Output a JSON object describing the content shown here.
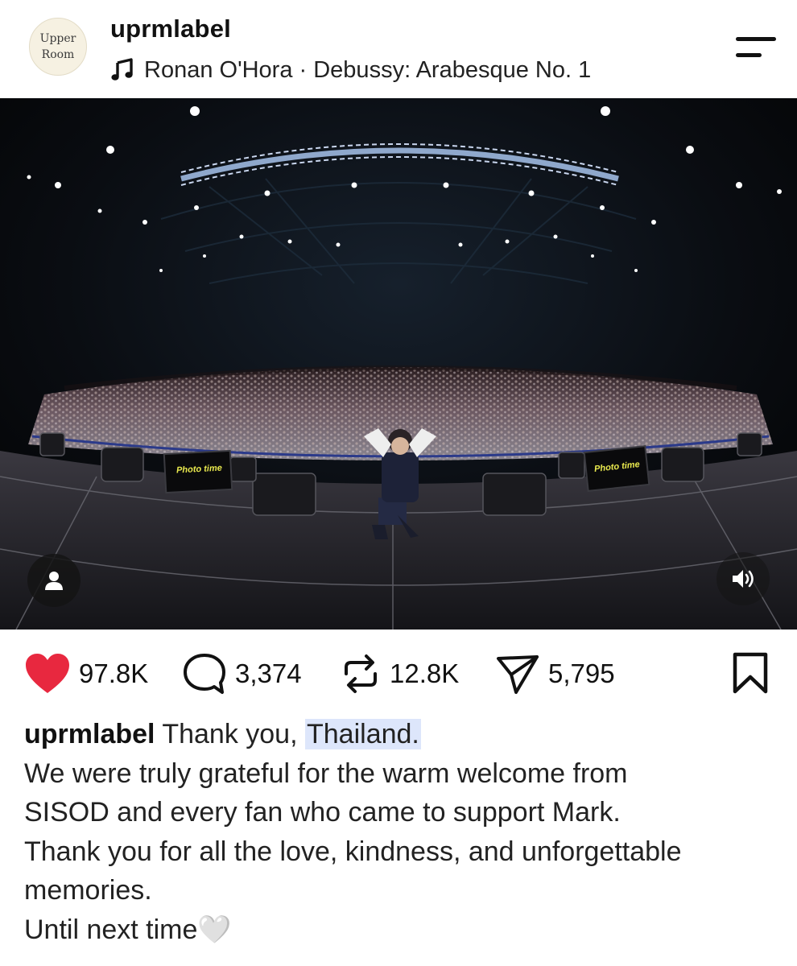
{
  "header": {
    "avatar_text_line1": "Upper",
    "avatar_text_line2": "Room",
    "username": "uprmlabel",
    "music_icon": "music-note-icon",
    "music_text": "Ronan O'Hora · Debussy: Arabesque No. 1",
    "menu_icon": "menu-icon"
  },
  "media": {
    "screen_label_left": "Photo time",
    "screen_label_right": "Photo time",
    "tag_icon": "user-tag-icon",
    "sound_icon": "speaker-icon"
  },
  "actions": {
    "like": {
      "icon": "heart-icon",
      "count": "97.8K",
      "color": "#e8283f"
    },
    "comment": {
      "icon": "comment-icon",
      "count": "3,374"
    },
    "repost": {
      "icon": "repost-icon",
      "count": "12.8K"
    },
    "share": {
      "icon": "send-icon",
      "count": "5,795"
    },
    "bookmark": {
      "icon": "bookmark-icon"
    }
  },
  "caption": {
    "username": "uprmlabel",
    "first_text": "Thank you,",
    "highlighted": "Thailand.",
    "line2": "We were truly grateful for the warm welcome from",
    "line3": "SISOD and every fan who came to support Mark.",
    "line4": "Thank you for all the love, kindness, and unforgettable",
    "line5": "memories.",
    "line6": "Until next time🤍",
    "highlight_color": "#dde6fb"
  }
}
